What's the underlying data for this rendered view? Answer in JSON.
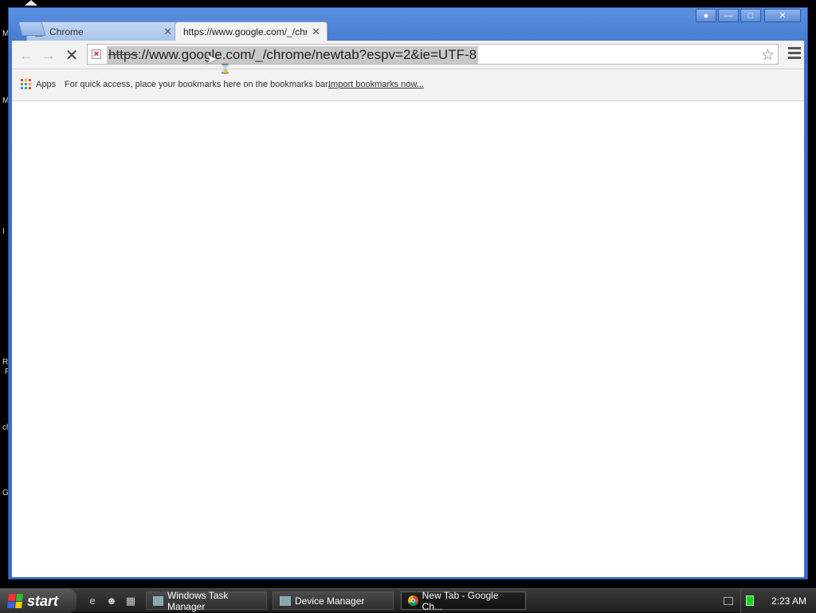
{
  "desktop": {
    "fragments": [
      "M",
      "M",
      "I",
      "R",
      "F",
      "cl",
      "G"
    ]
  },
  "browser": {
    "tabs": [
      {
        "title": "Chrome",
        "active": false
      },
      {
        "title": "https://www.google.com/_/chrome",
        "active": true
      }
    ],
    "url": {
      "scheme": "https",
      "rest": "://www.google.com/_/chrome/newtab?espv=2&ie=UTF-8"
    },
    "bookmarks": {
      "apps_label": "Apps",
      "hint": "For quick access, place your bookmarks here on the bookmarks bar.",
      "import_link": "Import bookmarks now..."
    }
  },
  "taskbar": {
    "start_label": "start",
    "tasks": [
      {
        "label": "Windows Task Manager"
      },
      {
        "label": "Device Manager"
      },
      {
        "label": "New Tab - Google Ch..."
      }
    ],
    "clock": "2:23 AM"
  },
  "colors": {
    "window_frame": "#3f74cc",
    "taskbar": "#2a2a2a"
  }
}
